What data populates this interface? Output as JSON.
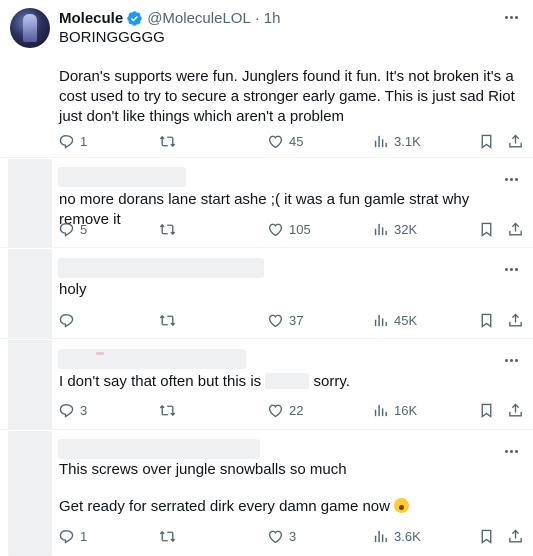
{
  "main_post": {
    "name": "Molecule",
    "handle": "@MoleculeLOL",
    "separator": "·",
    "time": "1h",
    "line1": "BORINGGGGG",
    "body": "Doran's supports were fun. Junglers found it fun. It's not broken it's a cost used to try to secure a stronger early game. This is just sad Riot just don't like things which aren't a problem",
    "replies": "1",
    "retweets": "",
    "likes": "45",
    "views": "3.1K",
    "verified_color": "#1d9bf0"
  },
  "replies": [
    {
      "text": "no more dorans lane start ashe ;( it was a fun gamle strat why remove it",
      "replies": "5",
      "retweets": "",
      "likes": "105",
      "views": "32K"
    },
    {
      "text": "holy",
      "replies": "",
      "retweets": "",
      "likes": "37",
      "views": "45K"
    },
    {
      "text_before": "I don't say that often but this is ",
      "text_after": " sorry.",
      "replies": "3",
      "retweets": "",
      "likes": "22",
      "views": "16K"
    },
    {
      "line1": "This screws over jungle snowballs so much",
      "line2": "Get ready for serrated dirk every damn game now",
      "emoji": "yawning-face-emoji",
      "replies": "1",
      "retweets": "",
      "likes": "3",
      "views": "3.6K"
    }
  ],
  "colors": {
    "text": "#0f1419",
    "secondary": "#536471",
    "divider": "#eff3f4",
    "verified": "#1d9bf0"
  }
}
